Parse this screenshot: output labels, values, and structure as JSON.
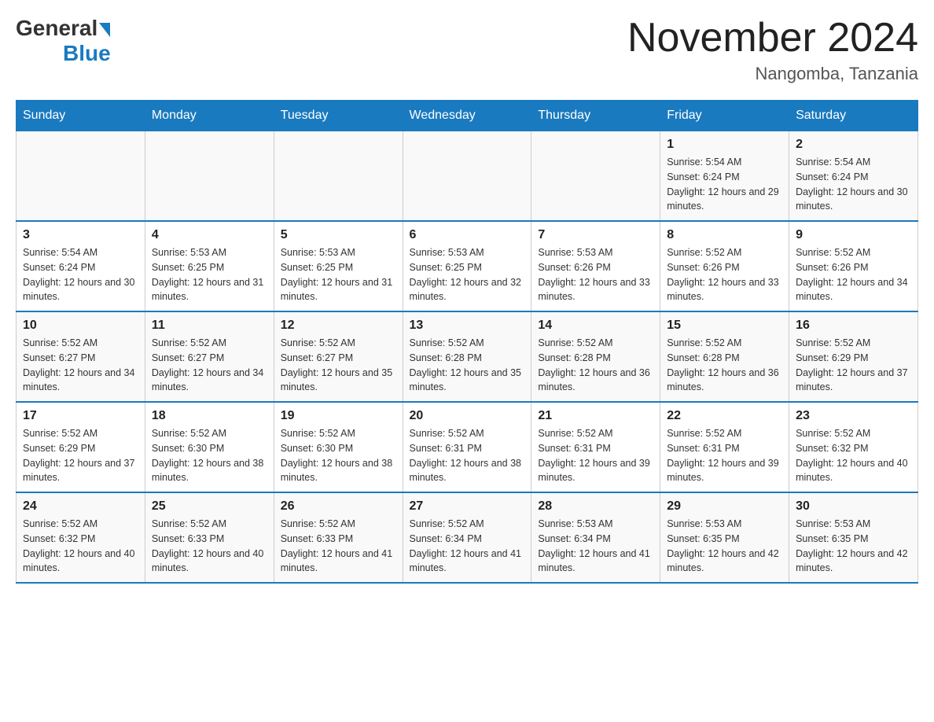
{
  "header": {
    "logo_general": "General",
    "logo_blue": "Blue",
    "month_title": "November 2024",
    "location": "Nangomba, Tanzania"
  },
  "days_of_week": [
    "Sunday",
    "Monday",
    "Tuesday",
    "Wednesday",
    "Thursday",
    "Friday",
    "Saturday"
  ],
  "weeks": [
    [
      {
        "day": "",
        "info": ""
      },
      {
        "day": "",
        "info": ""
      },
      {
        "day": "",
        "info": ""
      },
      {
        "day": "",
        "info": ""
      },
      {
        "day": "",
        "info": ""
      },
      {
        "day": "1",
        "info": "Sunrise: 5:54 AM\nSunset: 6:24 PM\nDaylight: 12 hours and 29 minutes."
      },
      {
        "day": "2",
        "info": "Sunrise: 5:54 AM\nSunset: 6:24 PM\nDaylight: 12 hours and 30 minutes."
      }
    ],
    [
      {
        "day": "3",
        "info": "Sunrise: 5:54 AM\nSunset: 6:24 PM\nDaylight: 12 hours and 30 minutes."
      },
      {
        "day": "4",
        "info": "Sunrise: 5:53 AM\nSunset: 6:25 PM\nDaylight: 12 hours and 31 minutes."
      },
      {
        "day": "5",
        "info": "Sunrise: 5:53 AM\nSunset: 6:25 PM\nDaylight: 12 hours and 31 minutes."
      },
      {
        "day": "6",
        "info": "Sunrise: 5:53 AM\nSunset: 6:25 PM\nDaylight: 12 hours and 32 minutes."
      },
      {
        "day": "7",
        "info": "Sunrise: 5:53 AM\nSunset: 6:26 PM\nDaylight: 12 hours and 33 minutes."
      },
      {
        "day": "8",
        "info": "Sunrise: 5:52 AM\nSunset: 6:26 PM\nDaylight: 12 hours and 33 minutes."
      },
      {
        "day": "9",
        "info": "Sunrise: 5:52 AM\nSunset: 6:26 PM\nDaylight: 12 hours and 34 minutes."
      }
    ],
    [
      {
        "day": "10",
        "info": "Sunrise: 5:52 AM\nSunset: 6:27 PM\nDaylight: 12 hours and 34 minutes."
      },
      {
        "day": "11",
        "info": "Sunrise: 5:52 AM\nSunset: 6:27 PM\nDaylight: 12 hours and 34 minutes."
      },
      {
        "day": "12",
        "info": "Sunrise: 5:52 AM\nSunset: 6:27 PM\nDaylight: 12 hours and 35 minutes."
      },
      {
        "day": "13",
        "info": "Sunrise: 5:52 AM\nSunset: 6:28 PM\nDaylight: 12 hours and 35 minutes."
      },
      {
        "day": "14",
        "info": "Sunrise: 5:52 AM\nSunset: 6:28 PM\nDaylight: 12 hours and 36 minutes."
      },
      {
        "day": "15",
        "info": "Sunrise: 5:52 AM\nSunset: 6:28 PM\nDaylight: 12 hours and 36 minutes."
      },
      {
        "day": "16",
        "info": "Sunrise: 5:52 AM\nSunset: 6:29 PM\nDaylight: 12 hours and 37 minutes."
      }
    ],
    [
      {
        "day": "17",
        "info": "Sunrise: 5:52 AM\nSunset: 6:29 PM\nDaylight: 12 hours and 37 minutes."
      },
      {
        "day": "18",
        "info": "Sunrise: 5:52 AM\nSunset: 6:30 PM\nDaylight: 12 hours and 38 minutes."
      },
      {
        "day": "19",
        "info": "Sunrise: 5:52 AM\nSunset: 6:30 PM\nDaylight: 12 hours and 38 minutes."
      },
      {
        "day": "20",
        "info": "Sunrise: 5:52 AM\nSunset: 6:31 PM\nDaylight: 12 hours and 38 minutes."
      },
      {
        "day": "21",
        "info": "Sunrise: 5:52 AM\nSunset: 6:31 PM\nDaylight: 12 hours and 39 minutes."
      },
      {
        "day": "22",
        "info": "Sunrise: 5:52 AM\nSunset: 6:31 PM\nDaylight: 12 hours and 39 minutes."
      },
      {
        "day": "23",
        "info": "Sunrise: 5:52 AM\nSunset: 6:32 PM\nDaylight: 12 hours and 40 minutes."
      }
    ],
    [
      {
        "day": "24",
        "info": "Sunrise: 5:52 AM\nSunset: 6:32 PM\nDaylight: 12 hours and 40 minutes."
      },
      {
        "day": "25",
        "info": "Sunrise: 5:52 AM\nSunset: 6:33 PM\nDaylight: 12 hours and 40 minutes."
      },
      {
        "day": "26",
        "info": "Sunrise: 5:52 AM\nSunset: 6:33 PM\nDaylight: 12 hours and 41 minutes."
      },
      {
        "day": "27",
        "info": "Sunrise: 5:52 AM\nSunset: 6:34 PM\nDaylight: 12 hours and 41 minutes."
      },
      {
        "day": "28",
        "info": "Sunrise: 5:53 AM\nSunset: 6:34 PM\nDaylight: 12 hours and 41 minutes."
      },
      {
        "day": "29",
        "info": "Sunrise: 5:53 AM\nSunset: 6:35 PM\nDaylight: 12 hours and 42 minutes."
      },
      {
        "day": "30",
        "info": "Sunrise: 5:53 AM\nSunset: 6:35 PM\nDaylight: 12 hours and 42 minutes."
      }
    ]
  ]
}
